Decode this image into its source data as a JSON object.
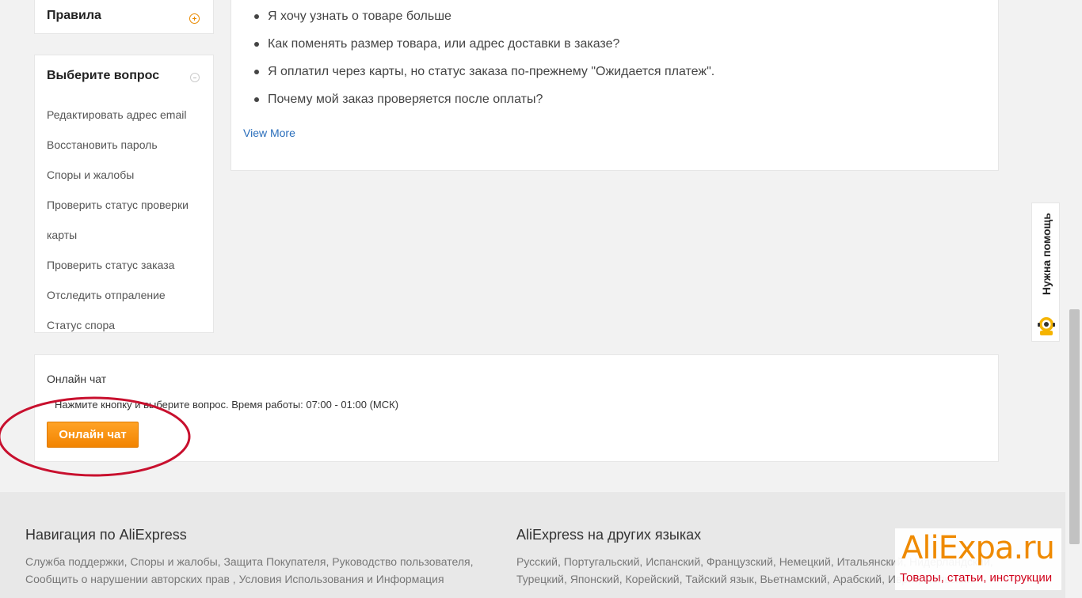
{
  "sidebar": {
    "rules_title": "Правила",
    "question_title": "Выберите вопрос",
    "questions": [
      "Редактировать адрес email",
      "Восстановить пароль",
      "Споры и жалобы",
      "Проверить статус проверки карты",
      "Проверить статус заказа",
      "Отследить отпраление",
      "Статус спора"
    ]
  },
  "faq": {
    "items": [
      "Я хочу узнать о товаре больше",
      "Как поменять размер товара, или адрес доставки в заказе?",
      "Я оплатил через карты, но статус заказа по-прежнему \"Ожидается платеж\".",
      "Почему мой заказ проверяется после оплаты?"
    ],
    "view_more": "View More"
  },
  "chat": {
    "title": "Онлайн чат",
    "hint": "Нажмите кнопку и выберите вопрос. Время работы: 07:00 - 01:00 (МСК)",
    "button": "Онлайн чат"
  },
  "help_tab": {
    "label": "Нужна помощь"
  },
  "footer": {
    "nav_heading": "Навигация по AliExpress",
    "nav_text": "Служба поддержки, Споры и жалобы, Защита Покупателя, Руководство пользователя, Сообщить о нарушении авторских прав , Условия Использования и Информация",
    "lang_heading": "AliExpress на других языках",
    "lang_text": "Русский, Португальский, Испанский, Французский, Немецкий, Итальянский, Нидерландский, Турецкий, Японский, Корейский, Тайский язык, Вьетнамский, Арабский, Иврит, Польский"
  },
  "watermark": {
    "logo": "AliExpa.ru",
    "tagline": "Товары, статьи, инструкции"
  },
  "colors": {
    "accent": "#f28400",
    "link": "#2a6ebb",
    "annotation": "#c8102e",
    "watermark_tagline": "#d0021b"
  },
  "icons": {
    "rules_toggle": "plus-circle-icon",
    "question_toggle": "minus-circle-icon",
    "help": "robot-icon"
  }
}
